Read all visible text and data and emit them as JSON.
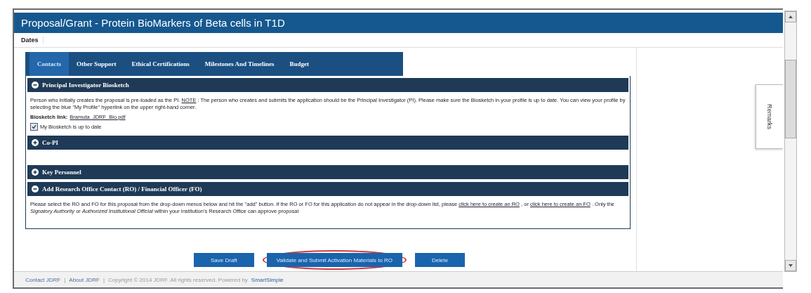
{
  "window": {
    "title": "Proposal/Grant - Protein BioMarkers of Beta cells in T1D"
  },
  "subnav": {
    "label": "Dates"
  },
  "tabs": [
    {
      "label": "Contacts",
      "selected": true
    },
    {
      "label": "Other Support",
      "selected": false
    },
    {
      "label": "Ethical Certifications",
      "selected": false
    },
    {
      "label": "Milestones And Timelines",
      "selected": false
    },
    {
      "label": "Budget",
      "selected": false
    }
  ],
  "sections": [
    {
      "title": "Principal Investigator Biosketch",
      "expanded": true,
      "body": [
        {
          "kind": "paragraph",
          "parts": [
            {
              "kind": "text",
              "text": "Person who initially creates the proposal is pre-loaded as the PI."
            },
            {
              "kind": "link",
              "text": "NOTE"
            },
            {
              "kind": "text",
              "text": ": The person who creates and submits the application should be the Principal Investigator (PI). Please make sure the Biosketch in your profile is up to date. You can view your profile by selecting the blue \"My Profile\" hyperlink on the upper right-hand corner."
            }
          ]
        },
        {
          "kind": "file",
          "label": "Biosketch link:",
          "link": "Bramuta_JDRF_Bio.pdf"
        },
        {
          "kind": "checkbox",
          "label": "My Biosketch is up to date",
          "checked": true
        }
      ]
    },
    {
      "title": "Co-PI",
      "expanded": false
    },
    {
      "title": "Key Personnel",
      "expanded": false
    },
    {
      "title": "Add Research Office Contact (RO) / Financial Officer (FO)",
      "expanded": true,
      "body": [
        {
          "kind": "paragraph",
          "parts": [
            {
              "kind": "text",
              "text": "Please select the RO and FO for this proposal from the drop-down menus below and hit the \"add\" button. If the RO or FO for this application do not appear in the drop-down list, please"
            },
            {
              "kind": "link",
              "text": "click here to create an RO"
            },
            {
              "kind": "text",
              "text": ", or"
            },
            {
              "kind": "link",
              "text": "click here to create an FO"
            },
            {
              "kind": "text",
              "text": ". Only the *Signatory Authority* or *Authorized Institutional Official* within your Institution's Research Office can approve proposal"
            }
          ]
        }
      ]
    }
  ],
  "actions": [
    {
      "label": "Save Draft",
      "highlighted": false
    },
    {
      "label": "Validate and Submit Activation Materials to RO",
      "highlighted": true
    },
    {
      "label": "Delete",
      "highlighted": false
    }
  ],
  "side_tab": {
    "label": "Remarks"
  },
  "footer": [
    {
      "kind": "link",
      "text": "Contact JDRF"
    },
    {
      "kind": "sep",
      "text": "|"
    },
    {
      "kind": "link",
      "text": "About JDRF"
    },
    {
      "kind": "sep",
      "text": "|"
    },
    {
      "kind": "text",
      "text": "Copyright © 2014 JDRF. All rights reserved. Powered by"
    },
    {
      "kind": "brand",
      "text": "SmartSimple"
    }
  ]
}
